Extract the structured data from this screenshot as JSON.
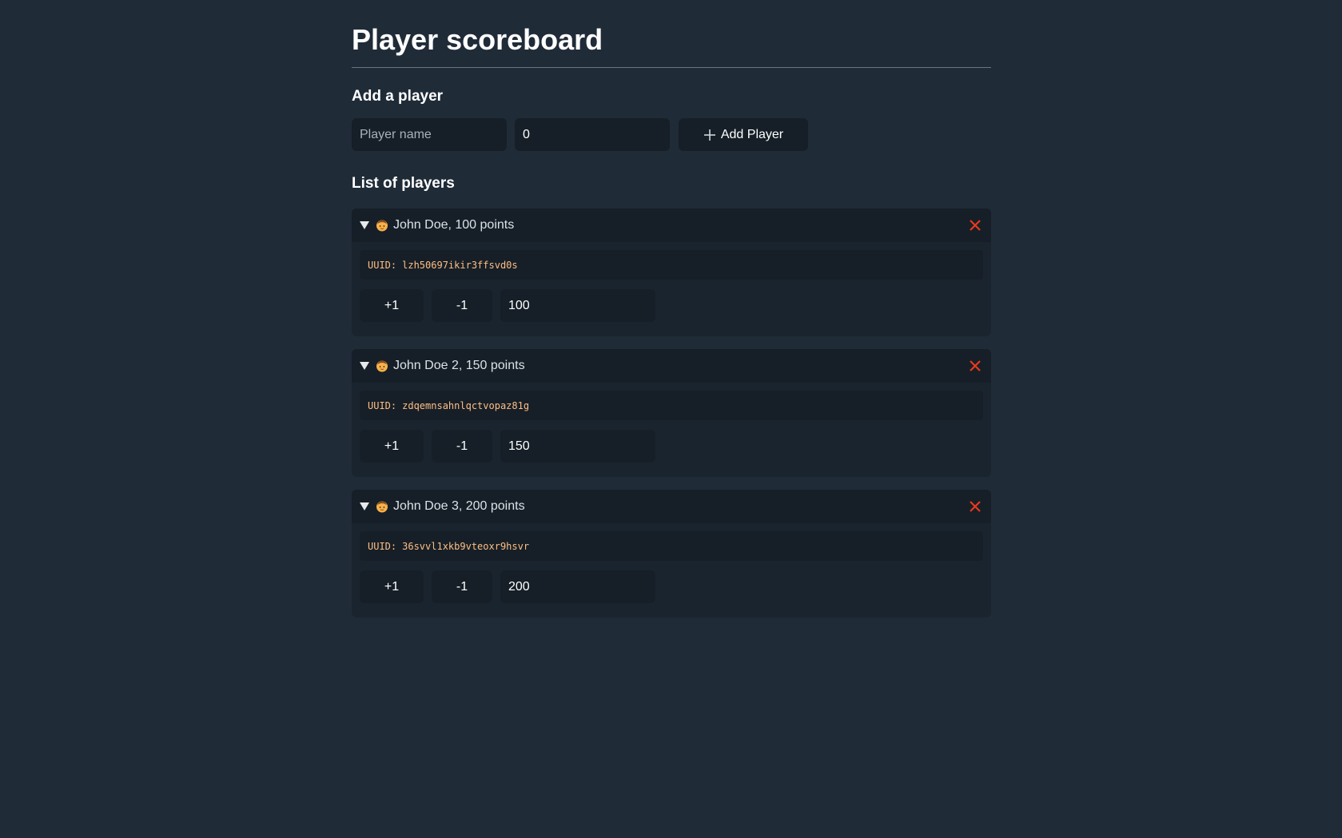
{
  "page": {
    "title": "Player scoreboard"
  },
  "add_section": {
    "title": "Add a player",
    "name_placeholder": "Player name",
    "name_value": "",
    "score_value": "0",
    "add_button_label": "Add Player",
    "add_button_icon": "plus-icon"
  },
  "list_section": {
    "title": "List of players"
  },
  "players": [
    {
      "summary": "John Doe, 100 points",
      "avatar_icon": "person-face-icon",
      "uuid_label": "UUID:",
      "uuid": "lzh50697ikir3ffsvd0s",
      "plus_label": "+1",
      "minus_label": "-1",
      "score_value": "100"
    },
    {
      "summary": "John Doe 2, 150 points",
      "avatar_icon": "person-face-icon",
      "uuid_label": "UUID:",
      "uuid": "zdqemnsahnlqctvopaz81g",
      "plus_label": "+1",
      "minus_label": "-1",
      "score_value": "150"
    },
    {
      "summary": "John Doe 3, 200 points",
      "avatar_icon": "person-face-icon",
      "uuid_label": "UUID:",
      "uuid": "36svvl1xkb9vteoxr9hsvr",
      "plus_label": "+1",
      "minus_label": "-1",
      "score_value": "200"
    }
  ],
  "colors": {
    "background": "#202b38",
    "panel": "#1a242f",
    "field": "#161f27",
    "uuid_text": "#ffbe85",
    "delete_icon": "#e8391d"
  }
}
